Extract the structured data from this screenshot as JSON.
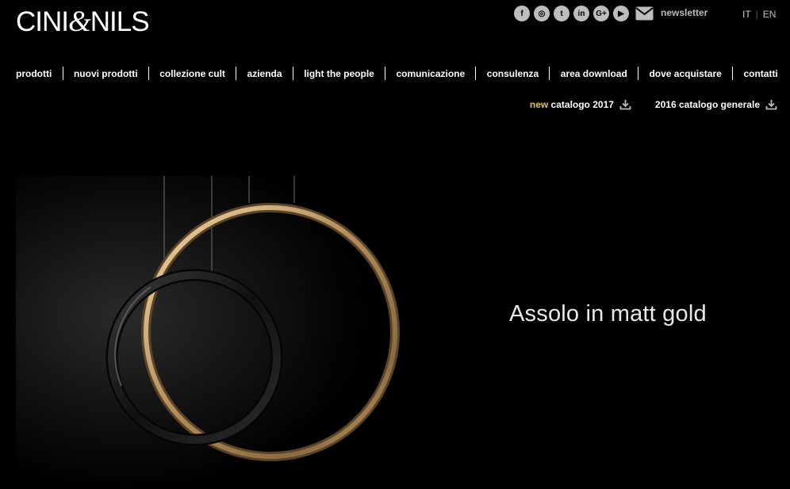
{
  "header": {
    "logo": {
      "left": "CINI",
      "amp": "&",
      "right": "NILS"
    },
    "social": [
      {
        "icon": "facebook-icon",
        "glyph": "f"
      },
      {
        "icon": "instagram-icon",
        "glyph": "◎"
      },
      {
        "icon": "twitter-icon",
        "glyph": "t"
      },
      {
        "icon": "linkedin-icon",
        "glyph": "in"
      },
      {
        "icon": "google-plus-icon",
        "glyph": "G+"
      },
      {
        "icon": "youtube-icon",
        "glyph": "▶"
      }
    ],
    "newsletter": "newsletter",
    "lang": {
      "it": "IT",
      "en": "EN"
    }
  },
  "nav": {
    "items": [
      "prodotti",
      "nuovi prodotti",
      "collezione cult",
      "azienda",
      "light the people",
      "comunicazione",
      "consulenza",
      "area download",
      "dove acquistare",
      "contatti"
    ]
  },
  "catalogs": {
    "new_prefix": "new",
    "new_label": "catalogo 2017",
    "general_label": "2016 catalogo generale"
  },
  "hero": {
    "tagline": "Assolo in matt gold"
  },
  "colors": {
    "background": "#000000",
    "accent_new": "#e2c14a",
    "gold_ring": "#c9a877",
    "black_ring": "#1a1a1a"
  }
}
